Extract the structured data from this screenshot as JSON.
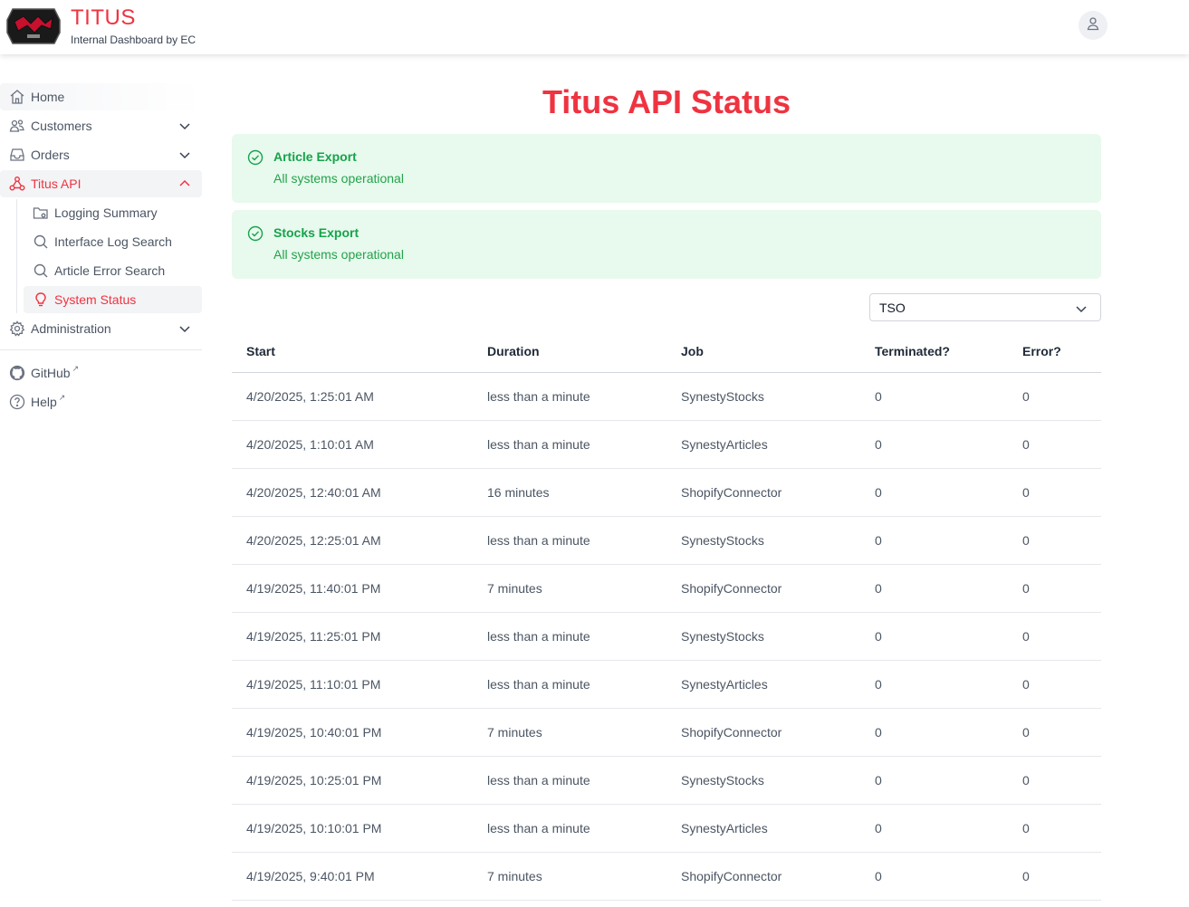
{
  "header": {
    "brand_title": "TITUS",
    "brand_subtitle": "Internal Dashboard by EC",
    "accent_color": "#ef3340"
  },
  "sidebar": {
    "items": [
      {
        "label": "Home",
        "icon": "home-icon"
      },
      {
        "label": "Customers",
        "icon": "users-icon"
      },
      {
        "label": "Orders",
        "icon": "inbox-icon"
      },
      {
        "label": "Titus API",
        "icon": "webhook-icon"
      },
      {
        "label": "Administration",
        "icon": "gear-icon"
      }
    ],
    "subitems": [
      {
        "label": "Logging Summary",
        "icon": "folder-gear-icon"
      },
      {
        "label": "Interface Log Search",
        "icon": "search-icon"
      },
      {
        "label": "Article Error Search",
        "icon": "search-icon"
      },
      {
        "label": "System Status",
        "icon": "lightbulb-icon"
      }
    ],
    "external": [
      {
        "label": "GitHub",
        "icon": "github-icon"
      },
      {
        "label": "Help",
        "icon": "help-circle-icon"
      }
    ]
  },
  "main": {
    "title": "Titus API Status",
    "statuses": [
      {
        "title": "Article Export",
        "text": "All systems operational"
      },
      {
        "title": "Stocks Export",
        "text": "All systems operational"
      }
    ],
    "filter": {
      "value": "TSO"
    },
    "table": {
      "headers": [
        "Start",
        "Duration",
        "Job",
        "Terminated?",
        "Error?"
      ],
      "rows": [
        [
          "4/20/2025, 1:25:01 AM",
          "less than a minute",
          "SynestyStocks",
          "0",
          "0"
        ],
        [
          "4/20/2025, 1:10:01 AM",
          "less than a minute",
          "SynestyArticles",
          "0",
          "0"
        ],
        [
          "4/20/2025, 12:40:01 AM",
          "16 minutes",
          "ShopifyConnector",
          "0",
          "0"
        ],
        [
          "4/20/2025, 12:25:01 AM",
          "less than a minute",
          "SynestyStocks",
          "0",
          "0"
        ],
        [
          "4/19/2025, 11:40:01 PM",
          "7 minutes",
          "ShopifyConnector",
          "0",
          "0"
        ],
        [
          "4/19/2025, 11:25:01 PM",
          "less than a minute",
          "SynestyStocks",
          "0",
          "0"
        ],
        [
          "4/19/2025, 11:10:01 PM",
          "less than a minute",
          "SynestyArticles",
          "0",
          "0"
        ],
        [
          "4/19/2025, 10:40:01 PM",
          "7 minutes",
          "ShopifyConnector",
          "0",
          "0"
        ],
        [
          "4/19/2025, 10:25:01 PM",
          "less than a minute",
          "SynestyStocks",
          "0",
          "0"
        ],
        [
          "4/19/2025, 10:10:01 PM",
          "less than a minute",
          "SynestyArticles",
          "0",
          "0"
        ],
        [
          "4/19/2025, 9:40:01 PM",
          "7 minutes",
          "ShopifyConnector",
          "0",
          "0"
        ]
      ]
    }
  }
}
